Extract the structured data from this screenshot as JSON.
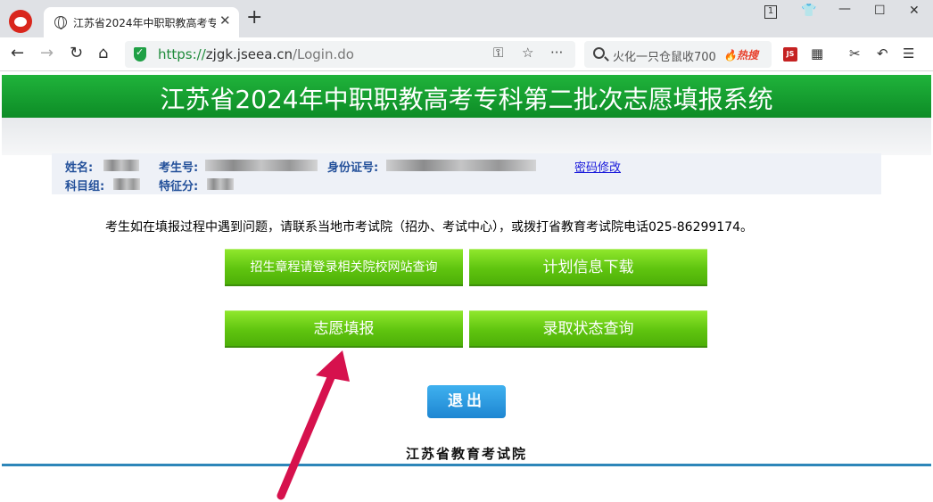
{
  "browser": {
    "tab_title": "江苏省2024年中职职教高考专",
    "url_scheme": "https://",
    "url_host": "zjgk.jseea.cn",
    "url_path": "/Login.do",
    "search_text": "火化一只仓鼠收700",
    "search_hot": "热搜",
    "tab_count": "1"
  },
  "page": {
    "banner_title": "江苏省2024年中职职教高考专科第二批次志愿填报系统",
    "labels": {
      "name": "姓名:",
      "exam_no": "考生号:",
      "id_no": "身份证号:",
      "subject_group": "科目组:",
      "special_code": "特征分:"
    },
    "password_link": "密码修改",
    "notice": "考生如在填报过程中遇到问题，请联系当地市考试院（招办、考试中心），或拨打省教育考试院电话025-86299174。",
    "buttons": {
      "admission_rules": "招生章程请登录相关院校网站查询",
      "plan_download": "计划信息下载",
      "volunteer_fill": "志愿填报",
      "admission_status": "录取状态查询",
      "exit": "退出"
    },
    "footer_org": "江苏省教育考试院"
  },
  "colors": {
    "banner_green": "#109a2e",
    "button_green": "#5fc40f",
    "exit_blue": "#2393dc",
    "label_blue": "#23509a",
    "arrow_red": "#d6114d"
  }
}
